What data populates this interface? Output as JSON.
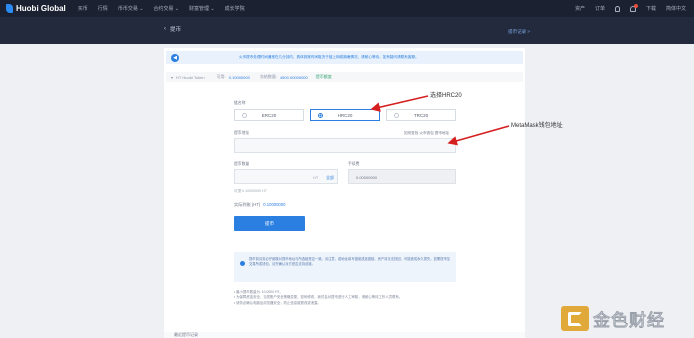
{
  "nav": {
    "brand": "Huobi Global",
    "items": [
      "买币",
      "行情",
      "币币交易 ⌄",
      "合约交易 ⌄",
      "财富管理 ⌄",
      "成长学院"
    ],
    "right": [
      "资产",
      "订单",
      "下载",
      "简体中文"
    ]
  },
  "page": {
    "title": "提币",
    "back_link": "提币记录 >",
    "notice": "火币提币处理时间通常在几分钟内，具体到账时间取决于链上网络拥堵情况，请耐心等待，如有疑问请联系客服。"
  },
  "token": {
    "name": "HT Huobi Token",
    "available_label": "可用:",
    "available_value": "0.10000000",
    "frozen_label": "冻结数量:",
    "frozen_value": "4500.00000000",
    "limit_link": "提币额度"
  },
  "form": {
    "chain_label": "链名称",
    "chains": [
      "ERC20",
      "HRC20",
      "TRC20"
    ],
    "selected_chain": "HRC20",
    "address_label": "提币地址",
    "address_help": "如何查找 火币钱包 提币地址",
    "amount_label": "提币数量",
    "amount_unit": "HT",
    "amount_all": "全部",
    "fee_label": "手续费",
    "fee_value": "0.00000000",
    "available_hint": "可提 0.10000000 HT",
    "receive_label": "实际到账 (HT)",
    "receive_value": "0.10000000",
    "submit": "提币"
  },
  "tips": {
    "box": "提币前请务必仔细核对提币地址与所选链是否一致。请注意，若地址填写错误或选错链，资产将无法找回，可能造成永久损失。如需提币至交易所或钱包，请先确认对方是否支持该链。",
    "notes": [
      "• 最小提币数量为: 10.0000 HT。",
      "• 为保障资金安全，当您账户安全策略变更、密码修改，我们会对提币进行人工审核，请耐心等待工作人员联系。",
      "• 请务必确认电脑及浏览器安全，防止信息被篡改或泄露。"
    ]
  },
  "bottom": {
    "label": "最近提币记录"
  },
  "annotations": {
    "choose_chain": "选择HRC20",
    "metamask": "MetaMask钱包地址"
  },
  "watermark": {
    "text": "金色财经"
  },
  "colors": {
    "nav_bg": "#1b2131",
    "subhead_bg": "#232a3d",
    "accent": "#2b7fe0",
    "arrow": "#d62020"
  }
}
